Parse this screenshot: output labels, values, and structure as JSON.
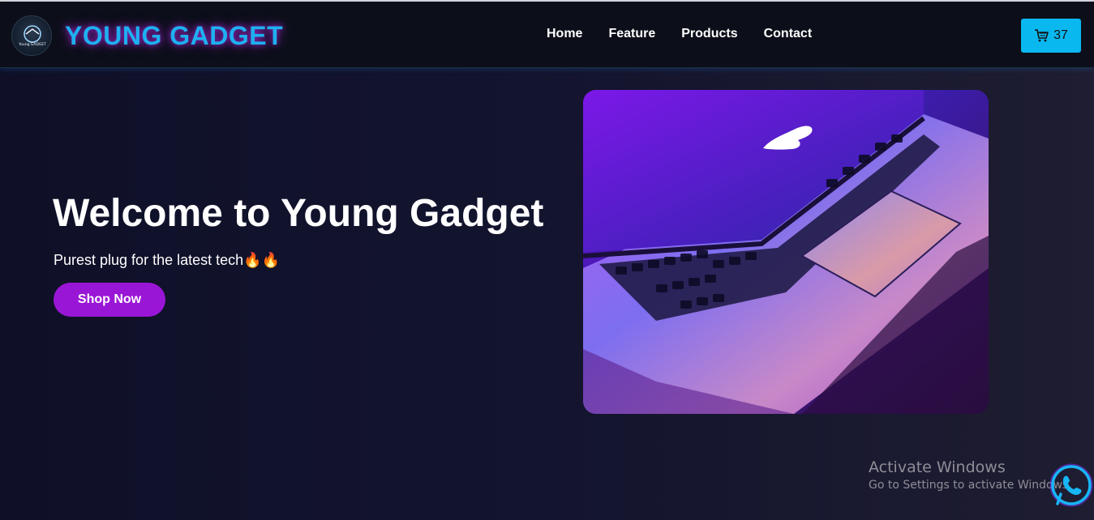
{
  "header": {
    "brand": "YOUNG GADGET",
    "logo_text": "Young GADGET",
    "nav": [
      {
        "label": "Home"
      },
      {
        "label": "Feature"
      },
      {
        "label": "Products"
      },
      {
        "label": "Contact"
      }
    ],
    "cart": {
      "icon": "cart-icon",
      "count": "37"
    }
  },
  "hero": {
    "title": "Welcome to Young Gadget",
    "subtitle": "Purest plug for the latest tech🔥🔥",
    "cta": "Shop Now",
    "image": "laptop-photo"
  },
  "overlay": {
    "activate_title": "Activate Windows",
    "activate_sub": "Go to Settings to activate Windows."
  },
  "whatsapp": {
    "icon": "whatsapp-icon"
  },
  "colors": {
    "accent_cyan": "#0ab8f0",
    "brand_purple": "#9a16d6",
    "background": "#0f1028"
  }
}
